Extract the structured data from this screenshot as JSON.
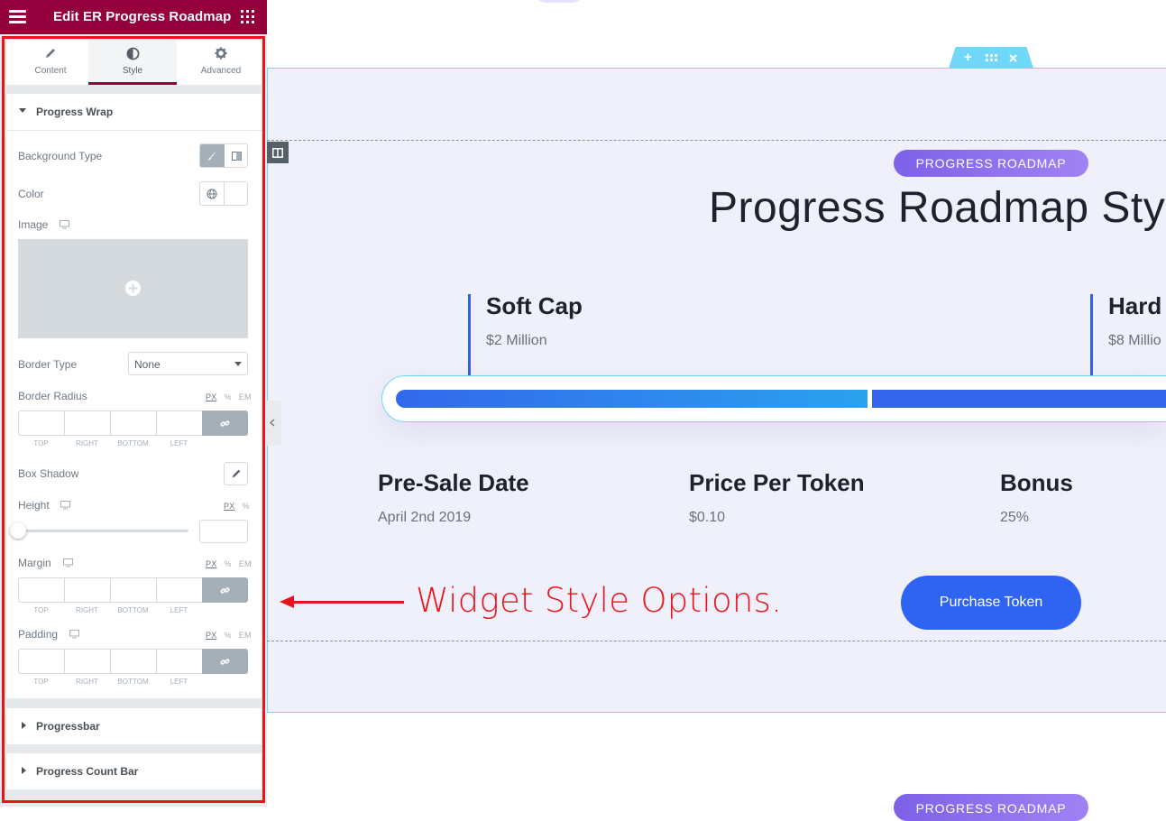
{
  "editor": {
    "title": "Edit ER Progress Roadmap",
    "tabs": [
      {
        "label": "Content",
        "icon": "pencil-icon"
      },
      {
        "label": "Style",
        "icon": "contrast-icon"
      },
      {
        "label": "Advanced",
        "icon": "gear-icon"
      }
    ],
    "active_tab": "Style",
    "sections": {
      "progress_wrap": {
        "label": "Progress Wrap",
        "background_type_label": "Background Type",
        "color_label": "Color",
        "image_label": "Image",
        "border_type_label": "Border Type",
        "border_type_value": "None",
        "border_radius_label": "Border Radius",
        "box_shadow_label": "Box Shadow",
        "height_label": "Height",
        "margin_label": "Margin",
        "padding_label": "Padding",
        "units_full": [
          "PX",
          "%",
          "EM"
        ],
        "units_short": [
          "PX",
          "%"
        ],
        "dim_labels": [
          "TOP",
          "RIGHT",
          "BOTTOM",
          "LEFT"
        ]
      },
      "progressbar": {
        "label": "Progressbar"
      },
      "progress_count_bar": {
        "label": "Progress Count Bar"
      }
    }
  },
  "canvas": {
    "badge": "PROGRESS ROADMAP",
    "heading": "Progress Roadmap Sty",
    "milestones": [
      {
        "title": "Soft Cap",
        "value": "$2 Million"
      },
      {
        "title": "Hard",
        "value": "$8 Millio"
      }
    ],
    "info": [
      {
        "title": "Pre-Sale Date",
        "value": "April 2nd 2019"
      },
      {
        "title": "Price Per Token",
        "value": "$0.10"
      },
      {
        "title": "Bonus",
        "value": "25%"
      }
    ],
    "button": "Purchase Token",
    "bottom_badge": "PROGRESS ROADMAP"
  },
  "annotation": "Widget Style Options.",
  "colors": {
    "editor_header": "#93003c",
    "annotation_red": "#e8141b",
    "progress_blue": "#2f63f2",
    "badge_purple": "#8f72ee"
  }
}
